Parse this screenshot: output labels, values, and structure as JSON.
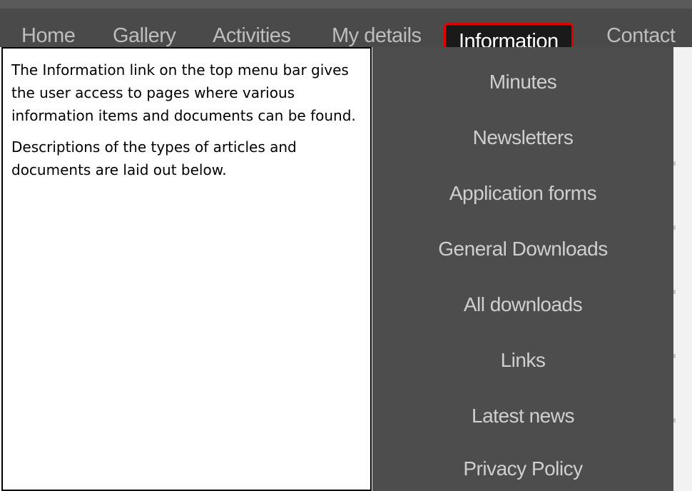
{
  "nav": {
    "items": [
      "Home",
      "Gallery",
      "Activities",
      "My details",
      "Information",
      "Contact"
    ],
    "active": "Information"
  },
  "dropdown": {
    "items": [
      "Minutes",
      "Newsletters",
      "Application forms",
      "General Downloads",
      "All downloads",
      "Links",
      "Latest news",
      "Privacy Policy"
    ]
  },
  "description": {
    "paragraphs": [
      "The Information link on the top menu bar gives the user access to pages where various information items and documents can be found.",
      "Descriptions of the types of articles and documents are laid out below."
    ]
  },
  "colors": {
    "nav_bg": "#4a4a4a",
    "active_bg": "#1a1a1a",
    "highlight": "#e00000",
    "dropdown_bg": "#4d4d4d"
  }
}
